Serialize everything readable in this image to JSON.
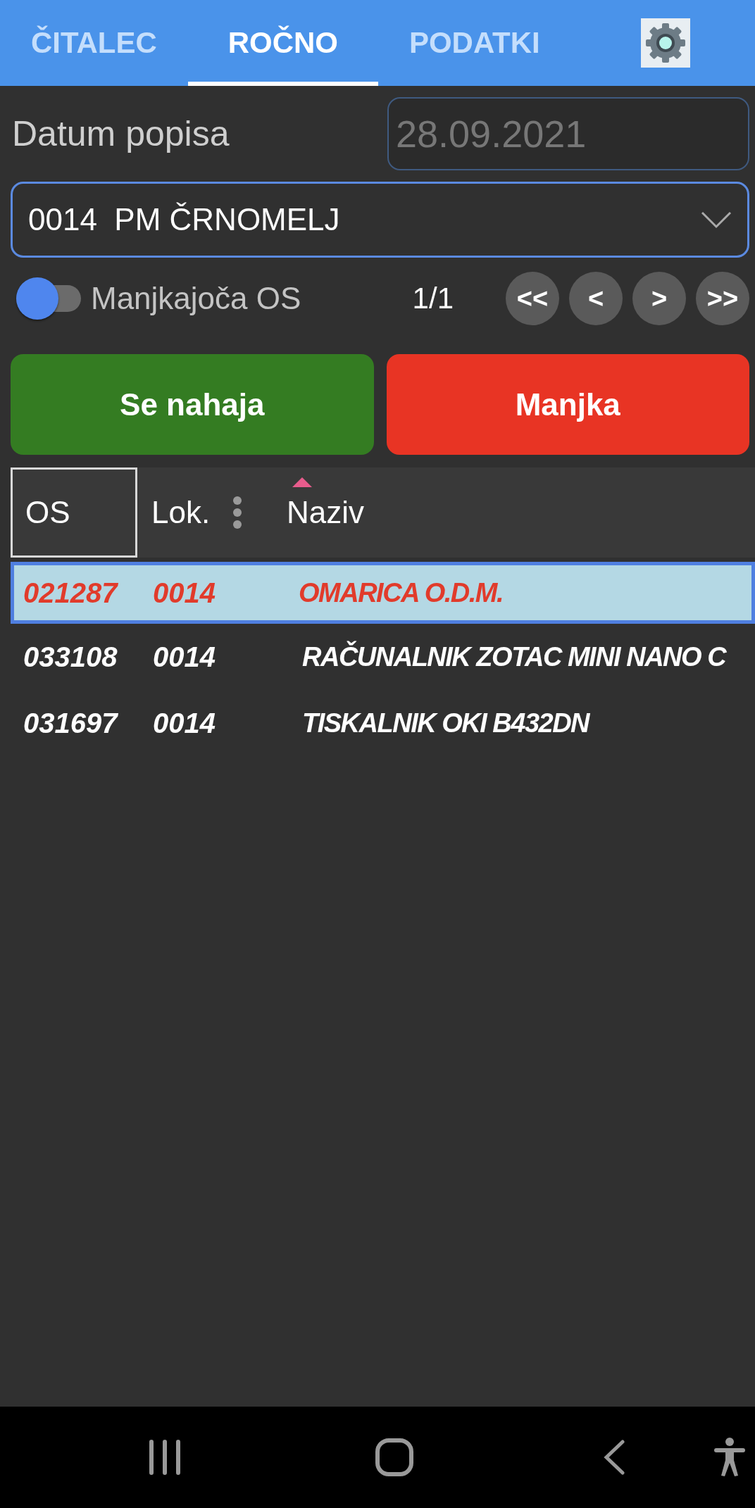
{
  "tabs": [
    {
      "label": "ČITALEC",
      "selected": false
    },
    {
      "label": "ROČNO",
      "selected": true
    },
    {
      "label": "PODATKI",
      "selected": false
    }
  ],
  "date": {
    "label": "Datum popisa",
    "value": "28.09.2021",
    "disabled": true
  },
  "location_select": {
    "value": "0014  PM ČRNOMELJ"
  },
  "missing_toggle": {
    "label": "Manjkajoča OS",
    "on": false
  },
  "pager": {
    "page": "1/1",
    "buttons": [
      "<<",
      "<",
      ">",
      ">>"
    ]
  },
  "actions": [
    {
      "label": "Se nahaja",
      "kind": "found"
    },
    {
      "label": "Manjka",
      "kind": "missing"
    }
  ],
  "table": {
    "columns": [
      {
        "label": "OS",
        "focused": true,
        "sorted": false,
        "menu": false
      },
      {
        "label": "Lok.",
        "focused": false,
        "sorted": false,
        "menu": true
      },
      {
        "label": "Naziv",
        "focused": false,
        "sorted": true,
        "menu": false
      }
    ],
    "rows": [
      {
        "cells": [
          "021287",
          "0014",
          "OMARICA O.D.M."
        ],
        "selected": true
      },
      {
        "cells": [
          "033108",
          "0014",
          "RAČUNALNIK ZOTAC MINI NANO C"
        ],
        "selected": false
      },
      {
        "cells": [
          "031697",
          "0014",
          "TISKALNIK OKI B432DN"
        ],
        "selected": false
      }
    ]
  }
}
